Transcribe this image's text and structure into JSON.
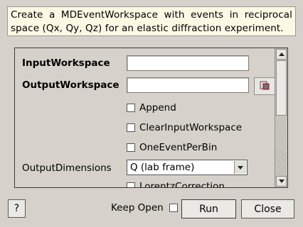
{
  "description": "Create a MDEventWorkspace with events in reciprocal space (Qx, Qy, Qz) for an elastic diffraction experiment.",
  "properties": {
    "input_workspace_label": "InputWorkspace",
    "input_workspace_value": "",
    "output_workspace_label": "OutputWorkspace",
    "output_workspace_value": "",
    "append_label": "Append",
    "append_checked": false,
    "clear_input_label": "ClearInputWorkspace",
    "clear_input_checked": false,
    "one_event_label": "OneEventPerBin",
    "one_event_checked": false,
    "output_dimensions_label": "OutputDimensions",
    "output_dimensions_value": "Q (lab frame)",
    "lorentz_label": "LorentzCorrection",
    "lorentz_checked": false
  },
  "footer": {
    "help_label": "?",
    "keep_open_label": "Keep Open",
    "keep_open_checked": false,
    "run_label": "Run",
    "close_label": "Close"
  },
  "icons": {
    "browse": "workspace-browse-icon",
    "scroll_up": "scroll-up-arrow-icon",
    "scroll_down": "scroll-down-arrow-icon",
    "dropdown": "dropdown-arrow-icon"
  }
}
